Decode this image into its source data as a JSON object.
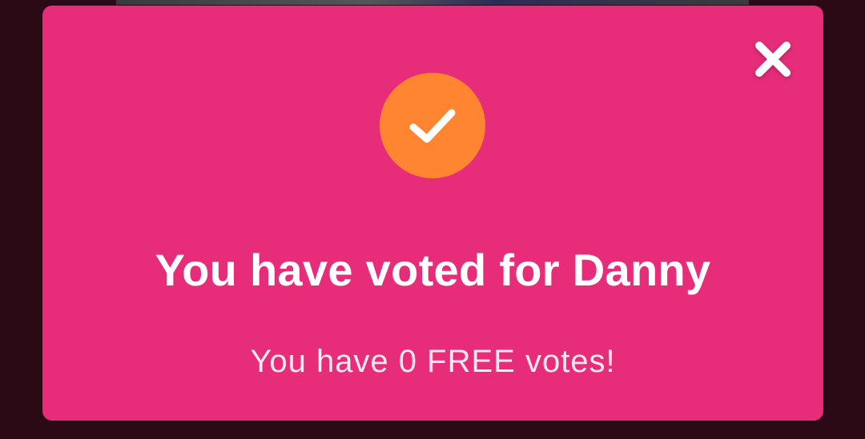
{
  "modal": {
    "title": "You have voted for Danny",
    "subtitle": "You have 0 FREE votes!",
    "close_icon": "close-icon",
    "status_icon": "checkmark-icon"
  },
  "colors": {
    "modal_background": "#e72d7a",
    "badge_background": "#ff8531",
    "page_background": "#2b0a16",
    "text": "#ffffff"
  }
}
